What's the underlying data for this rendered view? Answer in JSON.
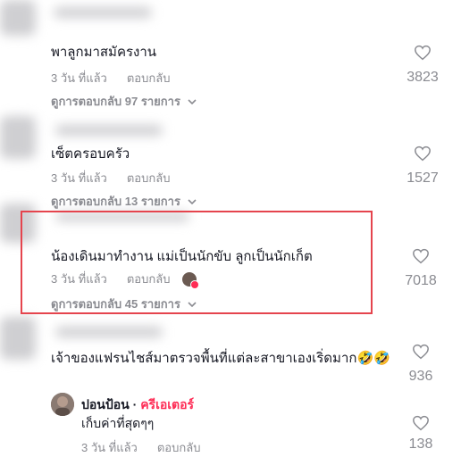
{
  "comments": [
    {
      "text": "พาลูกมาสมัครงาน",
      "time": "3 วัน ที่แล้ว",
      "reply": "ตอบกลับ",
      "view_replies": "ดูการตอบกลับ 97 รายการ",
      "likes": "3823"
    },
    {
      "text": "เซ็ตครอบครัว",
      "time": "3 วัน ที่แล้ว",
      "reply": "ตอบกลับ",
      "view_replies": "ดูการตอบกลับ 13 รายการ",
      "likes": "1527"
    },
    {
      "text": "น้องเดินมาทำงาน แม่เป็นนักขับ ลูกเป็นนักเก็ต",
      "time": "3 วัน ที่แล้ว",
      "reply": "ตอบกลับ",
      "view_replies": "ดูการตอบกลับ 45 รายการ",
      "likes": "7018"
    },
    {
      "text": "เจ้าของแฟรนไชส์มาตรวจพื้นที่แต่ละสาขาเองเริ่ดมาก🤣🤣",
      "likes": "936"
    }
  ],
  "reply_item": {
    "name": "ปอนป้อน",
    "separator": " · ",
    "badge": "ครีเอเตอร์",
    "text": "เก็บค่าที่สุดๆๆ",
    "time": "3 วัน ที่แล้ว",
    "reply": "ตอบกลับ",
    "likes": "138"
  },
  "colors": {
    "highlight_border": "#e5444d",
    "creator_badge": "#fe2c55",
    "muted_text": "#8a8b91"
  }
}
